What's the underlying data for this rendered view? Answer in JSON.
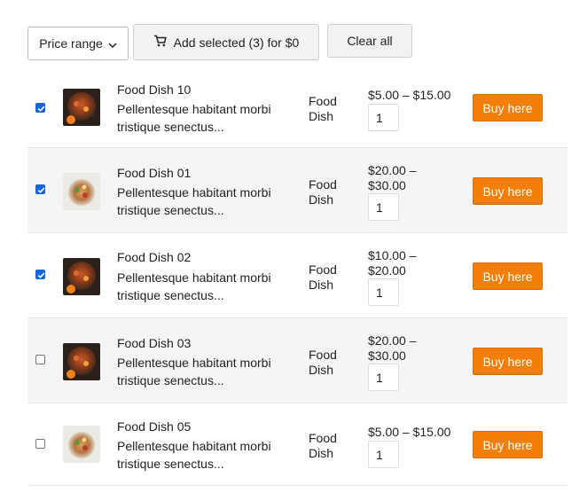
{
  "toolbar": {
    "price_range_label": "Price range",
    "add_selected_label": "Add selected (3) for $0",
    "clear_all_label": "Clear all"
  },
  "products": [
    {
      "title": "Food Dish 10",
      "description_line1": "Pellentesque habitant morbi",
      "description_line2": "tristique senectus...",
      "category_line1": "Food",
      "category_line2": "Dish",
      "price_line1": "$5.00 – $15.00",
      "price_line2": "",
      "quantity": "1",
      "buy_label": "Buy here",
      "checked": true,
      "thumbnail": "food-dish-photo"
    },
    {
      "title": "Food Dish 01",
      "description_line1": "Pellentesque habitant morbi",
      "description_line2": "tristique senectus...",
      "category_line1": "Food",
      "category_line2": "Dish",
      "price_line1": "$20.00 –",
      "price_line2": "$30.00",
      "quantity": "1",
      "buy_label": "Buy here",
      "checked": true,
      "thumbnail": "food-dish-photo"
    },
    {
      "title": "Food Dish 02",
      "description_line1": "Pellentesque habitant morbi",
      "description_line2": "tristique senectus...",
      "category_line1": "Food",
      "category_line2": "Dish",
      "price_line1": "$10.00 –",
      "price_line2": "$20.00",
      "quantity": "1",
      "buy_label": "Buy here",
      "checked": true,
      "thumbnail": "food-dish-photo"
    },
    {
      "title": "Food Dish 03",
      "description_line1": "Pellentesque habitant morbi",
      "description_line2": "tristique senectus...",
      "category_line1": "Food",
      "category_line2": "Dish",
      "price_line1": "$20.00 –",
      "price_line2": "$30.00",
      "quantity": "1",
      "buy_label": "Buy here",
      "checked": false,
      "thumbnail": "food-dish-photo"
    },
    {
      "title": "Food Dish 05",
      "description_line1": "Pellentesque habitant morbi",
      "description_line2": "tristique senectus...",
      "category_line1": "Food",
      "category_line2": "Dish",
      "price_line1": "$5.00 – $15.00",
      "price_line2": "",
      "quantity": "1",
      "buy_label": "Buy here",
      "checked": false,
      "thumbnail": "food-dish-photo"
    }
  ],
  "colors": {
    "buy_button": "#f17f0a",
    "checkbox_checked": "#1565d8",
    "row_alt_background": "#f5f5f5"
  }
}
